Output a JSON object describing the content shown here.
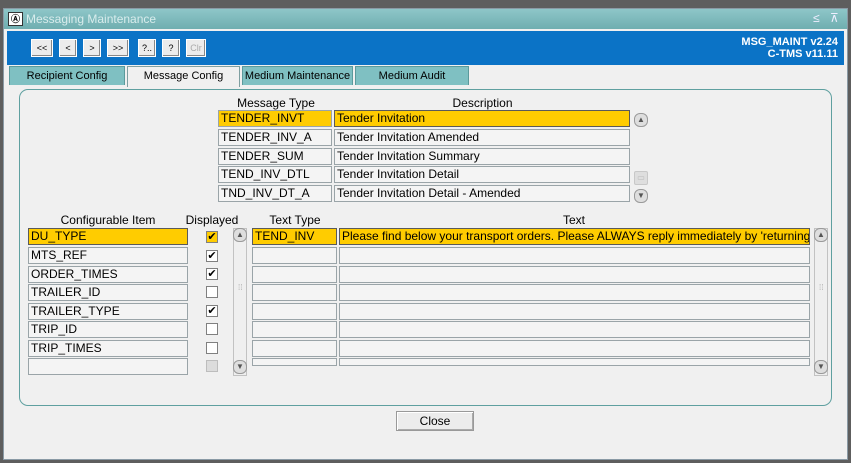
{
  "window": {
    "title": "Messaging Maintenance",
    "app_icon": "form-icon",
    "minimize_glyph": "≤",
    "maximize_glyph": "⊼"
  },
  "toolbar": {
    "buttons": [
      {
        "label": "<<",
        "enabled": true
      },
      {
        "label": "<",
        "enabled": true
      },
      {
        "label": ">",
        "enabled": true
      },
      {
        "label": ">>",
        "enabled": true
      },
      {
        "label": "?..",
        "enabled": true
      },
      {
        "label": "?",
        "enabled": true
      },
      {
        "label": "Clr",
        "enabled": false
      }
    ],
    "version_line1": "MSG_MAINT v2.24",
    "version_line2": "C-TMS v11.11"
  },
  "tabs": [
    {
      "label": "Recipient Config",
      "active": false
    },
    {
      "label": "Message Config",
      "active": true
    },
    {
      "label": "Medium Maintenance",
      "active": false
    },
    {
      "label": "Medium Audit",
      "active": false
    }
  ],
  "message_table": {
    "headers": {
      "type": "Message Type",
      "description": "Description"
    },
    "rows": [
      {
        "type": "TENDER_INVT",
        "description": "Tender Invitation",
        "selected": true
      },
      {
        "type": "TENDER_INV_A",
        "description": "Tender Invitation Amended",
        "selected": false
      },
      {
        "type": "TENDER_SUM",
        "description": "Tender Invitation Summary",
        "selected": false
      },
      {
        "type": "TEND_INV_DTL",
        "description": "Tender Invitation Detail",
        "selected": false
      },
      {
        "type": "TND_INV_DT_A",
        "description": "Tender Invitation Detail - Amended",
        "selected": false
      }
    ]
  },
  "items_table": {
    "headers": {
      "item": "Configurable Item",
      "displayed": "Displayed"
    },
    "rows": [
      {
        "item": "DU_TYPE",
        "checked": true,
        "selected": true
      },
      {
        "item": "MTS_REF",
        "checked": true,
        "selected": false
      },
      {
        "item": "ORDER_TIMES",
        "checked": true,
        "selected": false
      },
      {
        "item": "TRAILER_ID",
        "checked": false,
        "selected": false
      },
      {
        "item": "TRAILER_TYPE",
        "checked": true,
        "selected": false
      },
      {
        "item": "TRIP_ID",
        "checked": false,
        "selected": false
      },
      {
        "item": "TRIP_TIMES",
        "checked": false,
        "selected": false
      },
      {
        "item": "",
        "checked": false,
        "selected": false
      }
    ]
  },
  "text_table": {
    "headers": {
      "type": "Text Type",
      "text": "Text"
    },
    "rows": [
      {
        "type": "TEND_INV",
        "text": "Please find below your transport orders. Please ALWAYS reply immediately by 'returning",
        "selected": true
      },
      {
        "type": "",
        "text": "",
        "selected": false
      },
      {
        "type": "",
        "text": "",
        "selected": false
      },
      {
        "type": "",
        "text": "",
        "selected": false
      },
      {
        "type": "",
        "text": "",
        "selected": false
      },
      {
        "type": "",
        "text": "",
        "selected": false
      },
      {
        "type": "",
        "text": "",
        "selected": false
      }
    ]
  },
  "footer": {
    "close_label": "Close"
  },
  "colors": {
    "toolbar": "#0b73c6",
    "tab": "#7fc0c2",
    "selection": "#ffcc00",
    "titlebar": "#7fb8ba"
  }
}
